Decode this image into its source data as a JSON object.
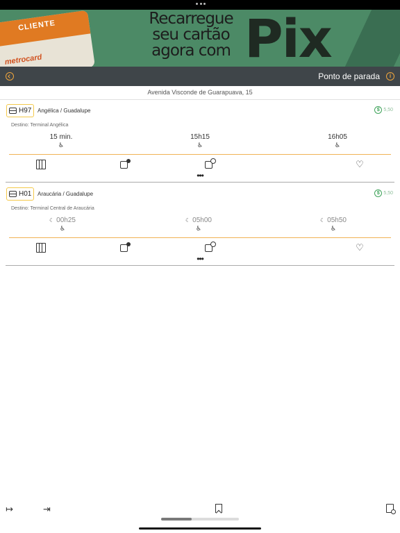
{
  "banner": {
    "card_label": "CLIENTE",
    "card_brand": "metrocard",
    "headline_line1": "Recarregue",
    "headline_line2": "seu cartão",
    "headline_line3": "agora com",
    "brand": "Pix"
  },
  "header": {
    "title": "Ponto de parada"
  },
  "stop": {
    "address": "Avenida Visconde de Guarapuava, 15"
  },
  "routes": [
    {
      "code": "H97",
      "name": "Angélica / Guadalupe",
      "fare": "5,50",
      "destination": "Destino: Terminal Angélica",
      "times": [
        {
          "value": "15 min.",
          "night": false
        },
        {
          "value": "15h15",
          "night": false
        },
        {
          "value": "16h05",
          "night": false
        }
      ]
    },
    {
      "code": "H01",
      "name": "Araucária / Guadalupe",
      "fare": "5,50",
      "destination": "Destino: Terminal Central de Araucária",
      "times": [
        {
          "value": "00h25",
          "night": true
        },
        {
          "value": "05h00",
          "night": true
        },
        {
          "value": "05h50",
          "night": true
        }
      ]
    }
  ],
  "icons": {
    "accessibility": "♿",
    "moon": "☾",
    "heart": "♡",
    "more": "•••",
    "sidebar_open": "↦",
    "sidebar_end": "⇥"
  },
  "colors": {
    "accent": "#f0a63d",
    "header_bg": "#3f4549",
    "fare_green": "#3fa35a",
    "badge_border": "#f4c94a"
  }
}
